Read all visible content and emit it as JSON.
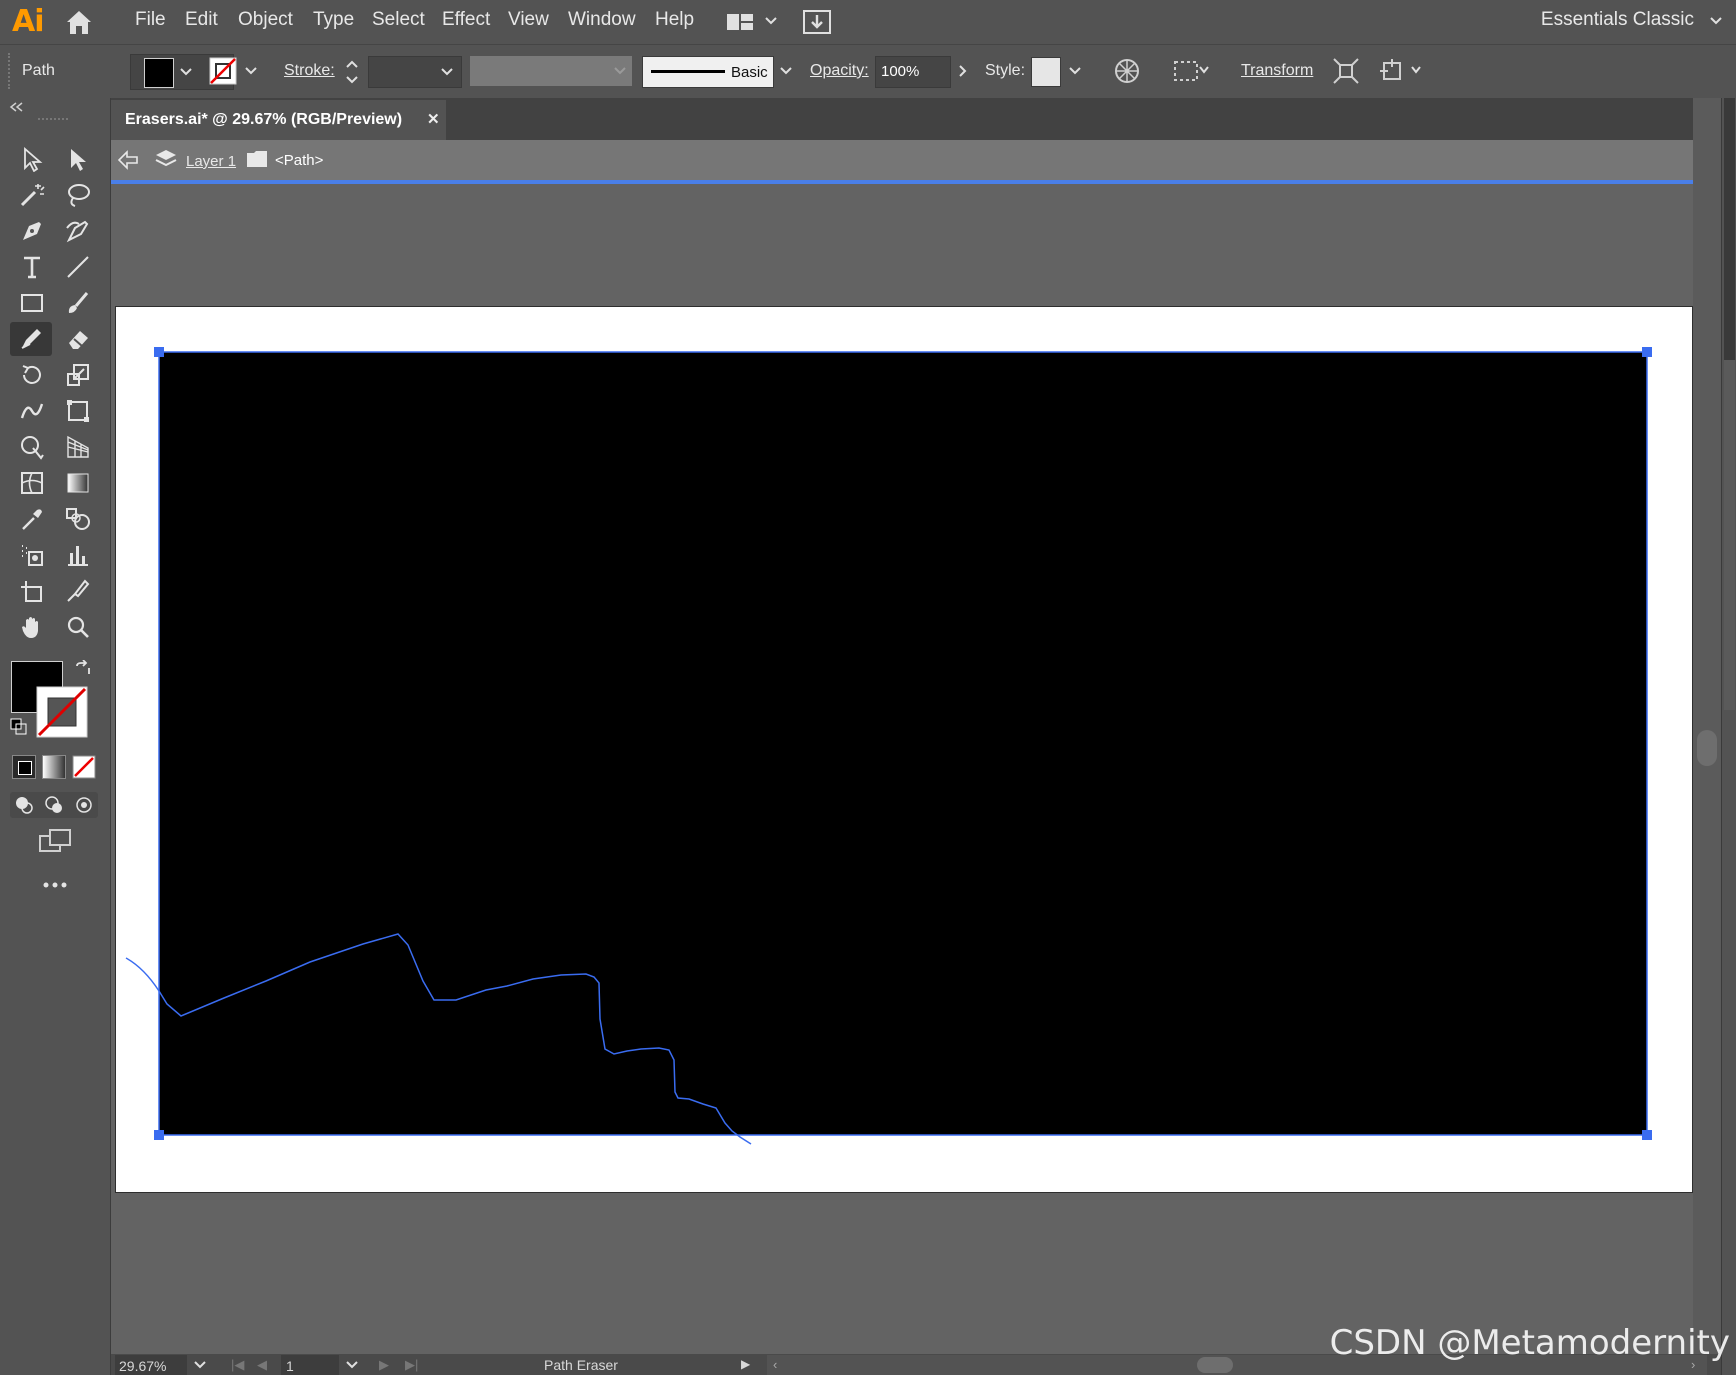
{
  "app": {
    "logo": "Ai",
    "menu": [
      "File",
      "Edit",
      "Object",
      "Type",
      "Select",
      "Effect",
      "View",
      "Window",
      "Help"
    ],
    "workspace": "Essentials Classic"
  },
  "control_bar": {
    "selection_type": "Path",
    "stroke_label": "Stroke:",
    "brush_style": "Basic",
    "opacity_label": "Opacity:",
    "opacity_value": "100%",
    "style_label": "Style:",
    "transform_label": "Transform",
    "fill_color": "#000000"
  },
  "document": {
    "tab_title": "Erasers.ai* @ 29.67% (RGB/Preview)",
    "close_glyph": "✕",
    "breadcrumb_layer": "Layer 1",
    "breadcrumb_object": "<Path>"
  },
  "status": {
    "zoom": "29.67%",
    "artboard_number": "1",
    "current_tool": "Path Eraser"
  },
  "colors": {
    "accent": "#4a7fe8",
    "selection": "#3a6cf0",
    "shape_fill": "#000000",
    "logo": "#ff9a00"
  },
  "watermark": "CSDN @Metamodernity",
  "toolbox_icons": [
    "selection-tool-icon",
    "direct-selection-tool-icon",
    "magic-wand-tool-icon",
    "lasso-tool-icon",
    "pen-tool-icon",
    "curvature-tool-icon",
    "type-tool-icon",
    "line-segment-tool-icon",
    "rectangle-tool-icon",
    "paintbrush-tool-icon",
    "shaper-tool-icon",
    "eraser-tool-icon",
    "rotate-tool-icon",
    "scale-tool-icon",
    "warp-tool-icon",
    "free-transform-tool-icon",
    "shape-builder-tool-icon",
    "perspective-grid-tool-icon",
    "mesh-tool-icon",
    "gradient-tool-icon",
    "eyedropper-tool-icon",
    "blend-tool-icon",
    "symbol-sprayer-tool-icon",
    "column-graph-tool-icon",
    "artboard-tool-icon",
    "slice-tool-icon",
    "hand-tool-icon",
    "zoom-tool-icon"
  ]
}
